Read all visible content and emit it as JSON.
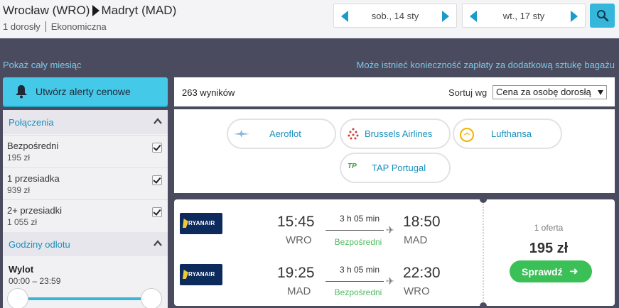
{
  "header": {
    "origin": "Wrocław (WRO)",
    "destination": "Madryt (MAD)",
    "passengers": "1 dorosły",
    "cabin": "Ekonomiczna",
    "depart_date": "sob., 14 sty",
    "return_date": "wt., 17 sty"
  },
  "links": {
    "show_month": "Pokaż cały miesiąc",
    "baggage_notice": "Może istnieć konieczność zapłaty za dodatkową sztukę bagażu"
  },
  "sidebar": {
    "alert_label": "Utwórz alerty cenowe",
    "connections_title": "Połączenia",
    "options": [
      {
        "name": "Bezpośredni",
        "price": "195 zł",
        "checked": true
      },
      {
        "name": "1 przesiadka",
        "price": "939 zł",
        "checked": true
      },
      {
        "name": "2+ przesiadki",
        "price": "1 055 zł",
        "checked": true
      }
    ],
    "departure_title": "Godziny odlotu",
    "departure_label": "Wylot",
    "departure_range": "00:00 – 23:59"
  },
  "results": {
    "count": "263 wyników",
    "sort_label": "Sortuj wg",
    "sort_value": "Cena za osobę dorosłą"
  },
  "airlines": [
    {
      "name": "Aeroflot"
    },
    {
      "name": "Brussels Airlines"
    },
    {
      "name": "Lufthansa"
    },
    {
      "name": "TAP Portugal",
      "logo_text": "TP"
    }
  ],
  "flight": {
    "carrier_logo_text": "RYANAIR",
    "outbound": {
      "dep_time": "15:45",
      "dep_code": "WRO",
      "arr_time": "18:50",
      "arr_code": "MAD",
      "duration": "3 h 05 min",
      "stops": "Bezpośredni"
    },
    "inbound": {
      "dep_time": "19:25",
      "dep_code": "MAD",
      "arr_time": "22:30",
      "arr_code": "WRO",
      "duration": "3 h 05 min",
      "stops": "Bezpośredni"
    },
    "offer_count": "1 oferta",
    "price": "195 zł",
    "cta": "Sprawdź"
  },
  "colors": {
    "accent": "#34b7db",
    "link": "#1a8fbd",
    "cta": "#3bbf57",
    "background": "#4a4b5f"
  }
}
